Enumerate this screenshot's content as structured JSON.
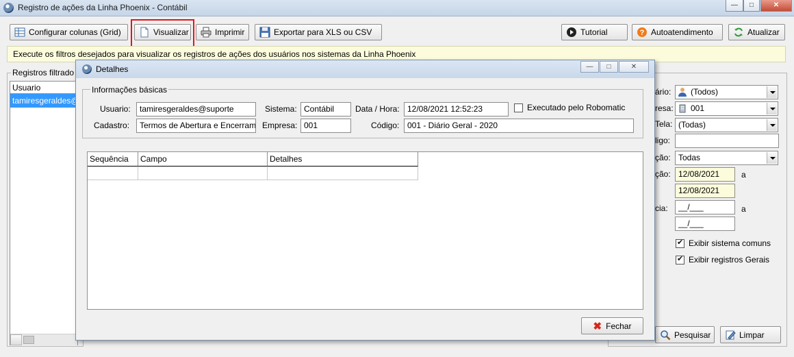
{
  "window": {
    "title": "Registro de ações da Linha Phoenix - Contábil",
    "min_glyph": "—",
    "max_glyph": "□",
    "close_glyph": "✕"
  },
  "toolbar": {
    "configurar": "Configurar colunas (Grid)",
    "visualizar": "Visualizar",
    "imprimir": "Imprimir",
    "exportar": "Exportar para XLS ou CSV",
    "tutorial": "Tutorial",
    "autoatendimento": "Autoatendimento",
    "atualizar": "Atualizar"
  },
  "info_bar": "Execute os filtros desejados para visualizar os registros de ações dos usuários nos sistemas da Linha Phoenix",
  "left_panel": {
    "group_label": "Registros filtrado",
    "column_header": "Usuario",
    "rows": [
      "tamiresgeraldes@"
    ]
  },
  "filters": {
    "usuario_label": "ário:",
    "usuario_value": "(Todos)",
    "empresa_label": "resa:",
    "empresa_value": "001",
    "tela_label": "Tela:",
    "tela_value": "(Todas)",
    "codigo_label": "ligo:",
    "codigo_value": "",
    "acao_label": "ção:",
    "acao_value": "Todas",
    "data_label": "ção:",
    "data_from": "12/08/2021",
    "data_to": "12/08/2021",
    "data_sep": "a",
    "ocorrencia_label": "cia:",
    "oc_from": "__/___",
    "oc_to": "__/___",
    "oc_sep": "a",
    "exibir_comuns": "Exibir sistema comuns",
    "exibir_gerais": "Exibir registros Gerais",
    "pesquisar": "Pesquisar",
    "limpar": "Limpar"
  },
  "dialog": {
    "title": "Detalhes",
    "group_label": "Informações básicas",
    "usuario_label": "Usuario:",
    "usuario_value": "tamiresgeraldes@suporte",
    "sistema_label": "Sistema:",
    "sistema_value": "Contábil",
    "data_label": "Data / Hora:",
    "data_value": "12/08/2021 12:52:23",
    "robomatic_label": "Executado pelo Robomatic",
    "cadastro_label": "Cadastro:",
    "cadastro_value": "Termos de Abertura e Encerrame",
    "empresa_label": "Empresa:",
    "empresa_value": "001",
    "codigo_label": "Código:",
    "codigo_value": "001 - Diário Geral - 2020",
    "grid_headers": [
      "Sequência",
      "Campo",
      "Detalhes"
    ],
    "fechar": "Fechar"
  },
  "colors": {
    "highlight_border": "#e0161e",
    "selected_row": "#3399ff",
    "info_bar_bg": "#fcfcdd"
  }
}
